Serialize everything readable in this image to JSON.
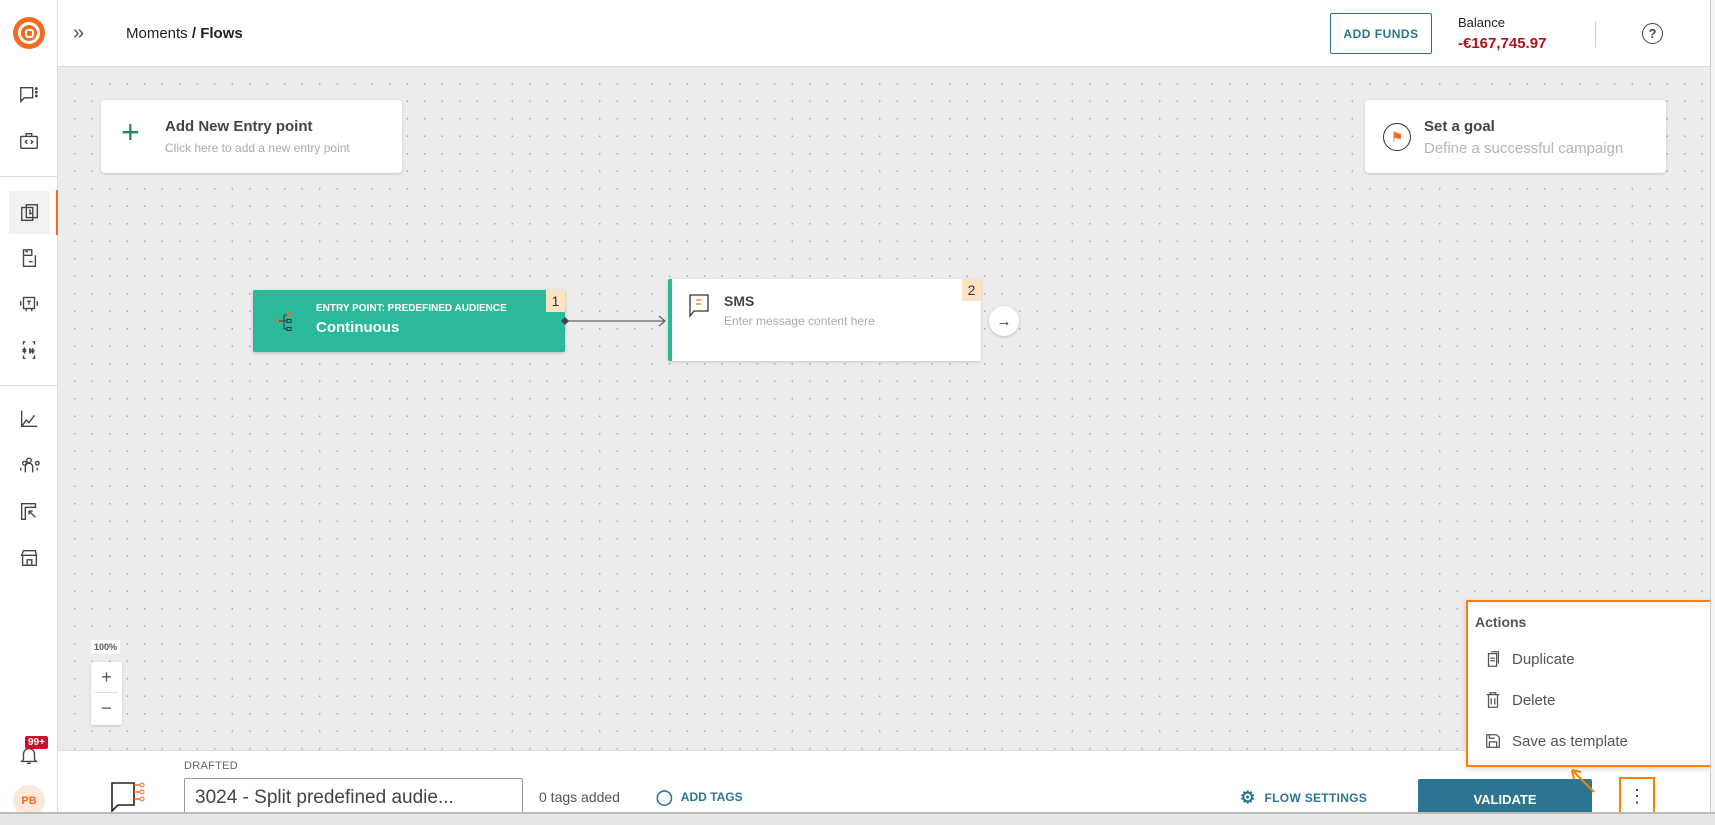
{
  "header": {
    "breadcrumb_parent": "Moments",
    "breadcrumb_sep": " / ",
    "breadcrumb_current": "Flows",
    "add_funds": "ADD FUNDS",
    "balance_label": "Balance",
    "balance_value": "-€167,745.97"
  },
  "sidebar": {
    "items": [
      "messages-icon",
      "api-icon",
      "moments-icon",
      "templates-icon",
      "bot-icon",
      "code-icon",
      "analytics-icon",
      "people-icon",
      "exports-icon",
      "store-icon"
    ],
    "active": "moments-icon",
    "notification_badge": "99+",
    "avatar": "PB"
  },
  "canvas": {
    "add_entry": {
      "title": "Add New Entry point",
      "subtitle": "Click here to add a new entry point"
    },
    "goal": {
      "title": "Set a goal",
      "subtitle": "Define a successful campaign"
    },
    "nodes": [
      {
        "number": "1",
        "label": "ENTRY POINT: PREDEFINED AUDIENCE",
        "title": "Continuous"
      },
      {
        "number": "2",
        "title": "SMS",
        "subtitle": "Enter message content here"
      }
    ],
    "zoom": "100%"
  },
  "footer": {
    "status": "DRAFTED",
    "flow_name": "3024 - Split predefined audie...",
    "tags": "0 tags added",
    "add_tags": "ADD TAGS",
    "flow_settings": "FLOW SETTINGS",
    "validate": "VALIDATE"
  },
  "actions_menu": {
    "title": "Actions",
    "items": [
      "Duplicate",
      "Delete",
      "Save as template"
    ]
  },
  "colors": {
    "accent": "#2b7593",
    "brand": "#f26b21",
    "node_green": "#2ab99a",
    "negative": "#b3101d",
    "highlight": "#ff8000"
  }
}
